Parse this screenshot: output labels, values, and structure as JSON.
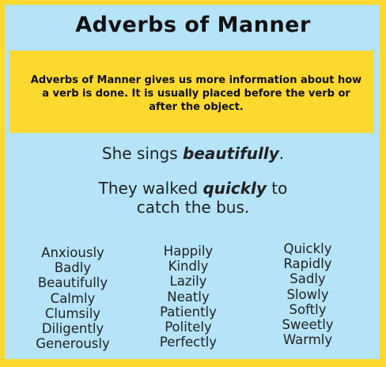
{
  "title": "Adverbs of Manner",
  "definition": "Adverbs of Manner gives us more information about how a verb is done. It is usually placed before the verb or after the object.",
  "sentences": [
    {
      "before": "She sings ",
      "adverb": "beautifully",
      "after": "."
    },
    {
      "before": "They walked ",
      "adverb": "quickly",
      "after": " to catch the bus."
    }
  ],
  "word_columns": [
    [
      "Anxiously",
      "Badly",
      "Beautifully",
      "Calmly",
      "Clumsily",
      "Diligently",
      "Generously"
    ],
    [
      "Happily",
      "Kindly",
      "Lazily",
      "Neatly",
      "Patiently",
      "Politely",
      "Perfectly"
    ],
    [
      "Quickly",
      "Rapidly",
      "Sadly",
      "Slowly",
      "Softly",
      "Sweetly",
      "Warmly"
    ]
  ],
  "colors": {
    "border": "#fbd92f",
    "background": "#b5e3f8",
    "definition_box": "#fbd92f"
  }
}
